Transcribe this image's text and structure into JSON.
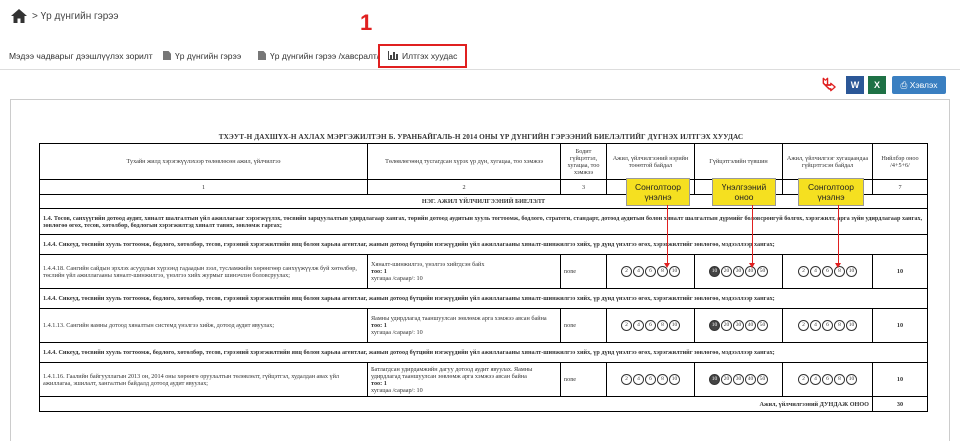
{
  "breadcrumb": {
    "text": "> Үр дүнгийн гэрээ"
  },
  "annotation": {
    "number": "1"
  },
  "tabs": [
    {
      "label": "Мэдээ чадварыг дээшлүүлэх зорилт"
    },
    {
      "label": "Үр дүнгийн гэрээ"
    },
    {
      "label": "Үр дүнгийн гэрээ /хавсралт/"
    },
    {
      "label": "Илтгэх хуудас"
    }
  ],
  "actions": {
    "print_label": "Хэвлэх",
    "word_label": "W",
    "excel_label": "X"
  },
  "document": {
    "title": "ТХЭУТ-Н ДАХШҮХ-Н АХЛАХ МЭРГЭЖИЛТЭН Б. УРАНБАЙГАЛЬ-Н 2014 ОНЫ ҮР ДҮНГИЙН ГЭРЭЭНИЙ БИЕЛЭЛТИЙГ ДҮГНЭХ ИЛТГЭХ ХУУДАС",
    "headers": [
      "Тухайн жилд хэрэгжүүлэхээр төлөвлөсөн ажил, үйлчилгээ",
      "Төлөвлөгөөнд тусгагдсан хүрэх үр дүн, хугацаа, тоо хэмжээ",
      "Бодит гүйцэтгэл, хугацаа, тоо хэмжээ",
      "Ажил, үйлчилгээний нэрийн тоөөтгой байдал",
      "Гүйцэтгэлийн түвшин",
      "Ажил, үйлчилгээг хугацаандаа гүйцэтгэсэн байдал",
      "Нийлбэр оноо /4+5+6/"
    ],
    "numbers": [
      "1",
      "2",
      "3",
      "4",
      "5",
      "6",
      "7"
    ],
    "section": "НЭГ. АЖИЛ ҮЙЛЧИЛГЭЭНИЙ БИЕЛЭЛТ",
    "group1": "1.4. Тосов, санхүүгийн дотоод аудит, хяналт шалгалтын үйл ажиллагааг хэрэгжүүлэх, төсвийн зарцуулалтын удирдлагаар хангах, төрийн дотоод аудитын хууль тогтоомж, бодлого, стратеги, стандарт, дотоод аудитын болон хяналт шалгалтын дүрмийг боловсронгуй болгох, хэрэгжилт, арга зүйн удирдлагаар хангах, зөвлөгөө өгөх, тесов, хөтөлбөр, бодлогын хэрэгжилтэд хяналт тавих, зөвлөмж гаргах;",
    "group2": "1.4.4. Сикеуд, төсвийн хууль тогтоомж, бодлого, хөтөлбөр, тесов, гэрээний хэрэгжилтийн явц болон харьяа агентлаг, жанын дотоод бүтцийн нэгжүүдийн үйл ажиллагааны хяналт-шинжилгээ хийх, үр дүнд үнэлгээ өгөх, хэрэгжилтийг зөвлөгөө, мэдээллээр хангах;",
    "rows": [
      {
        "task": "1.4.4.18. Сангийн сайдын эрхлэх асуудлын хүрээнд гадаадын зээл, тусламжийн хөрөнгөөр санхүүжүүлж буй хөтөлбөр, төслийн үйл ажиллагааны хяналт-шинжилгээ, үнэлгээ хийх журмыг шинэчлэн боловсруулах;",
        "plan": "Хяналт-шинжилгээ, үнэлгээ хийгдсэн байх",
        "plan_qty": "тоо: 1",
        "plan_deadline": "хугацаа /сараар/: 10",
        "actual": "none",
        "quality": [
          "2",
          "4",
          "6",
          "8",
          "10"
        ],
        "level": [
          "10",
          "20",
          "30",
          "40",
          "50"
        ],
        "timeliness": [
          "2",
          "4",
          "6",
          "8",
          "10"
        ],
        "score": "10"
      },
      {
        "task": "1.4.1.13. Сангийн яамны дотоод хяналтын системд үнэлгээ хийж, дотоод аудит явуулах;",
        "plan": "Яамны удирдлагад тааншуулсан зөвлөмж арга хэмжээ авсан байна",
        "plan_qty": "тоо: 1",
        "plan_deadline": "хугацаа /сараар/: 10",
        "actual": "none",
        "quality": [
          "2",
          "4",
          "6",
          "8",
          "10"
        ],
        "level": [
          "10",
          "20",
          "30",
          "40",
          "50"
        ],
        "timeliness": [
          "2",
          "4",
          "6",
          "8",
          "10"
        ],
        "score": "10"
      },
      {
        "task": "1.4.1.16. Гаалийн байгууллагын 2013 он, 2014 оны хөрөнгө оруулалтын төлөвлөлт, гүйцэтгэл, худалдан авах үйл ажиллагаа, эшилалт, хангалтын байдалд дотоод аудит явуулах;",
        "plan": "Батлагдсан удирдамжийн дагуу дотоод аудит явуулах. Яамны удирдлагад тааншуулсан зөвлөмж арга хэмжээ авсан байна",
        "plan_qty": "тоо: 1",
        "plan_deadline": "хугацаа /сараар/: 10",
        "actual": "none",
        "quality": [
          "2",
          "4",
          "6",
          "8",
          "10"
        ],
        "level": [
          "10",
          "20",
          "30",
          "40",
          "50"
        ],
        "timeliness": [
          "2",
          "4",
          "6",
          "8",
          "10"
        ],
        "score": "10"
      }
    ],
    "average_label": "Ажил, үйлчилгээний ДУНДАЖ ОНОО",
    "average_value": "30"
  },
  "callouts": [
    "Сонголтоор үнэлнэ",
    "Үнэлгээний оноо",
    "Сонголтоор үнэлнэ"
  ],
  "colors": {
    "accent": "#e02020",
    "callout": "#f5e020",
    "button": "#3a7fc1"
  }
}
